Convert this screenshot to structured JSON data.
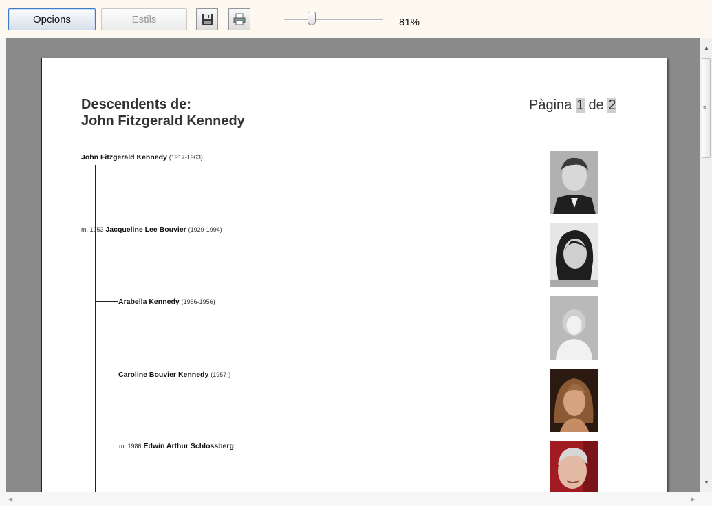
{
  "toolbar": {
    "options_label": "Opcions",
    "styles_label": "Estils",
    "save_icon": "save-icon",
    "print_icon": "print-icon",
    "zoom_level": 0.28,
    "zoom_label": "81%"
  },
  "document": {
    "title_line1": "Descendents de:",
    "title_line2": "John Fitzgerald Kennedy",
    "page_word": "Pàgina",
    "page_current": "1",
    "page_of": "de",
    "page_total": "2",
    "entries": [
      {
        "prefix": "",
        "name": "John Fitzgerald Kennedy",
        "dates": "(1917-1963)"
      },
      {
        "prefix": "m. 1953",
        "name": "Jacqueline Lee Bouvier",
        "dates": "(1929-1994)"
      },
      {
        "prefix": "",
        "name": "Arabella Kennedy",
        "dates": "(1956-1956)"
      },
      {
        "prefix": "",
        "name": "Caroline Bouvier Kennedy",
        "dates": "(1957-)"
      },
      {
        "prefix": "m. 1986",
        "name": "Edwin Arthur Schlossberg",
        "dates": ""
      }
    ]
  },
  "colors": {
    "toolbar_bg": "#fdf8f0",
    "viewer_bg": "#8a8a8a",
    "accent_border": "#3d7bd0"
  }
}
